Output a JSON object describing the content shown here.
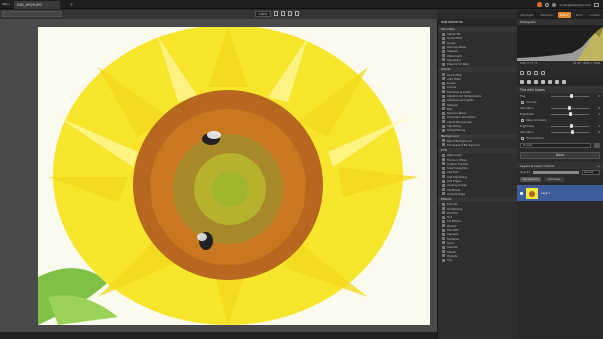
{
  "titlebar": {
    "menu_label": "Menu",
    "tab_label": "DSC_6929.JPG",
    "new_tab": "+",
    "account": "zoner@example.com"
  },
  "viewer_toolbar": {
    "path_text": "",
    "zoom_text": "100%"
  },
  "adjustments": {
    "title": "Adjustments",
    "sections": [
      {
        "title": "Favorites",
        "items": [
          "Adjust Tilt",
          "Quick Filter",
          "Levels",
          "Remove Noise",
          "Sharpen",
          "Watermark",
          "Vignetting",
          "Prepare for Web"
        ]
      },
      {
        "title": "Adjust",
        "items": [
          "Quick Filter",
          "Auto Filter",
          "Levels",
          "Curves",
          "Shadows & Lights",
          "Adjust Color Temperature",
          "Shadows and Lights",
          "Sharpen",
          "Blur",
          "Remove Noise",
          "Chromatic Aberration",
          "Adjust Perspective",
          "Vignetting",
          "Straightening"
        ]
      },
      {
        "title": "Background",
        "items": [
          "Blend Background",
          "Transparent Background"
        ]
      },
      {
        "title": "Edit",
        "items": [
          "Watermark",
          "Frame or Edge",
          "Custom Frames",
          "Insert Graphics",
          "Add Text",
          "Add Vignetting",
          "Add Edges",
          "Overlay Image",
          "3D Border",
          "Outside Edge"
        ]
      },
      {
        "title": "Effects",
        "items": [
          "Colorize",
          "Oil Painting",
          "Old Film",
          "Tint",
          "Art Effects",
          "Mosaic",
          "Tilt-Shift",
          "Vignette",
          "Posterize",
          "Glow",
          "Solarize",
          "Sketch",
          "Pixelate",
          "Fog"
        ]
      }
    ]
  },
  "right_panel": {
    "modes": [
      "Manager",
      "Develop",
      "Editor",
      "Print",
      "Create"
    ],
    "active_mode": "Editor",
    "histogram_title": "Histogram",
    "hist_info_left": "RGB: 0 / 0 / 0",
    "hist_info_right": "16 bit · 4000 × 3000",
    "filter_title": "Tint with Colors",
    "slider_1_label": "Hue",
    "slider_1_value": "0",
    "check_1_label": "Colorize",
    "slider_2_label": "Saturation",
    "slider_2_value": "0",
    "slider_3_label": "Brightness",
    "slider_3_value": "0",
    "check_2_label": "Keep luminosity",
    "slider_4_label": "Brightness",
    "slider_4_value": "0",
    "slider_5_label": "Saturation",
    "slider_5_value": "0",
    "check_3_label": "Fixed gamma",
    "preset_text": "Presets",
    "done_label": "Done",
    "layers_title": "Layers & Layer Control",
    "opacity_label": "Opacity",
    "blend_mode": "Normal",
    "layer_tab_1": "Background",
    "layer_tab_2": "Add Layer",
    "layer_name": "Layer 1"
  }
}
